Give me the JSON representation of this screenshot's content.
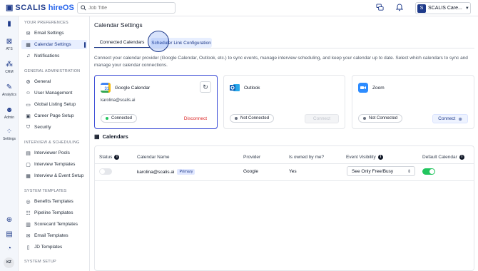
{
  "topbar": {
    "brand": "SCALIS",
    "product": "hireOS",
    "search_placeholder": "Job Title",
    "org_initial": "S",
    "org_name": "SCALIS Care..."
  },
  "rail": {
    "items": [
      {
        "label": ""
      },
      {
        "label": "ATS"
      },
      {
        "label": "CRM"
      },
      {
        "label": "Analytics"
      },
      {
        "label": "Admin"
      },
      {
        "label": "Settings"
      }
    ],
    "avatar": "KZ"
  },
  "sidenav": {
    "sections": [
      {
        "title": "YOUR PREFERENCES",
        "items": [
          "Email Settings",
          "Calendar Settings",
          "Notifications"
        ]
      },
      {
        "title": "GENERAL ADMINISTRATION",
        "items": [
          "General",
          "User Management",
          "Global Listing Setup",
          "Career Page Setup",
          "Security"
        ]
      },
      {
        "title": "INTERVIEW & SCHEDULING",
        "items": [
          "Interviewer Pools",
          "Interview Templates",
          "Interview & Event Setup"
        ]
      },
      {
        "title": "SYSTEM TEMPLATES",
        "items": [
          "Benefits Templates",
          "Pipeline Templates",
          "Scorecard Templates",
          "Email Templates",
          "JD Templates"
        ]
      },
      {
        "title": "SYSTEM SETUP",
        "items": []
      }
    ],
    "active": "Calendar Settings"
  },
  "main": {
    "title": "Calendar Settings",
    "tabs": [
      "Connected Calendars",
      "Scheduler Link Configuration"
    ],
    "description": "Connect your calendar provider (Google Calendar, Outlook, etc.) to sync events, manage interview scheduling, and keep your calendar up to date. Select which calendars to sync and manage your calendar connections.",
    "providers": [
      {
        "name": "Google Calendar",
        "email": "karolina@scalis.ai",
        "status": "Connected",
        "action": "Disconnect"
      },
      {
        "name": "Outlook",
        "status": "Not Connected",
        "action": "Connect"
      },
      {
        "name": "Zoom",
        "status": "Not Connected",
        "action": "Connect"
      }
    ],
    "calendars_title": "Calendars",
    "table": {
      "headers": [
        "Status",
        "Calendar Name",
        "Provider",
        "Is owned by me?",
        "Event Visibility",
        "Default Calendar"
      ],
      "rows": [
        {
          "calendar": "karolina@scalis.ai",
          "badge": "Primary",
          "provider": "Google",
          "owned": "Yes",
          "visibility": "See Only Free/Busy"
        }
      ]
    }
  },
  "colors": {
    "accent": "#1e3a8a",
    "connected": "#22c55e",
    "danger": "#dc2626"
  }
}
